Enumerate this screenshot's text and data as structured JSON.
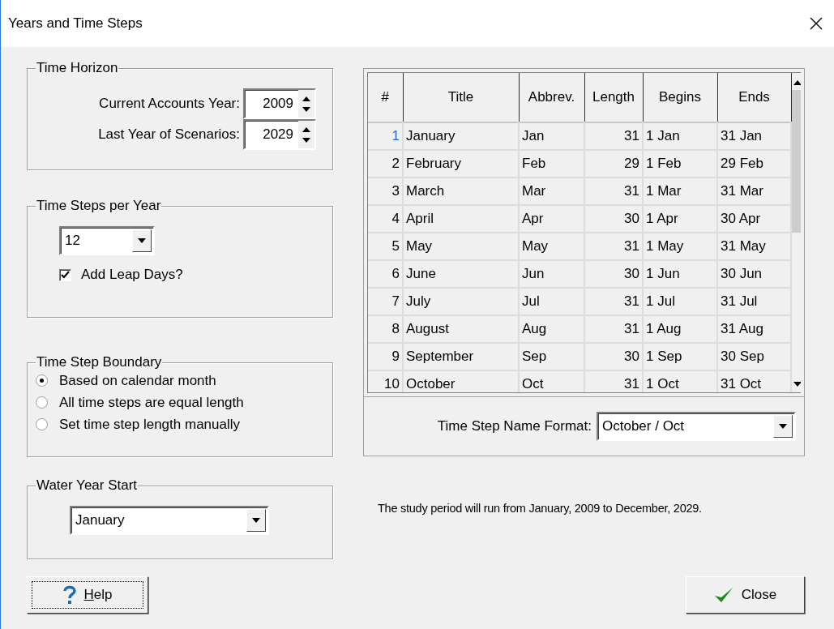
{
  "window": {
    "title": "Years and Time Steps"
  },
  "time_horizon": {
    "title": "Time Horizon",
    "fields": [
      {
        "label": "Current Accounts Year:",
        "value": "2009"
      },
      {
        "label": "Last Year of Scenarios:",
        "value": "2029"
      }
    ]
  },
  "time_steps_per_year": {
    "title": "Time Steps per Year",
    "value": "12",
    "leap_days": {
      "label": "Add Leap Days?",
      "checked": true
    }
  },
  "time_step_boundary": {
    "title": "Time Step Boundary",
    "options": [
      {
        "label": "Based on calendar month",
        "selected": true
      },
      {
        "label": "All time steps are equal length",
        "selected": false
      },
      {
        "label": "Set time step length manually",
        "selected": false
      }
    ]
  },
  "water_year_start": {
    "title": "Water Year Start",
    "value": "January"
  },
  "table": {
    "columns": [
      "#",
      "Title",
      "Abbrev.",
      "Length",
      "Begins",
      "Ends"
    ],
    "rows": [
      {
        "cells": [
          "1",
          "January",
          "Jan",
          "31",
          "1 Jan",
          "31 Jan"
        ],
        "selected": true
      },
      {
        "cells": [
          "2",
          "February",
          "Feb",
          "29",
          "1 Feb",
          "29 Feb"
        ],
        "selected": false
      },
      {
        "cells": [
          "3",
          "March",
          "Mar",
          "31",
          "1 Mar",
          "31 Mar"
        ],
        "selected": false
      },
      {
        "cells": [
          "4",
          "April",
          "Apr",
          "30",
          "1 Apr",
          "30 Apr"
        ],
        "selected": false
      },
      {
        "cells": [
          "5",
          "May",
          "May",
          "31",
          "1 May",
          "31 May"
        ],
        "selected": false
      },
      {
        "cells": [
          "6",
          "June",
          "Jun",
          "30",
          "1 Jun",
          "30 Jun"
        ],
        "selected": false
      },
      {
        "cells": [
          "7",
          "July",
          "Jul",
          "31",
          "1 Jul",
          "31 Jul"
        ],
        "selected": false
      },
      {
        "cells": [
          "8",
          "August",
          "Aug",
          "31",
          "1 Aug",
          "31 Aug"
        ],
        "selected": false
      },
      {
        "cells": [
          "9",
          "September",
          "Sep",
          "30",
          "1 Sep",
          "30 Sep"
        ],
        "selected": false
      },
      {
        "cells": [
          "10",
          "October",
          "Oct",
          "31",
          "1 Oct",
          "31 Oct"
        ],
        "selected": false
      }
    ]
  },
  "name_format": {
    "label": "Time Step Name Format:",
    "value": "October / Oct"
  },
  "summary": "The study period will run from January, 2009 to December, 2029.",
  "buttons": [
    {
      "label": "Help",
      "kind": "help"
    },
    {
      "label": "Close",
      "kind": "close"
    }
  ]
}
